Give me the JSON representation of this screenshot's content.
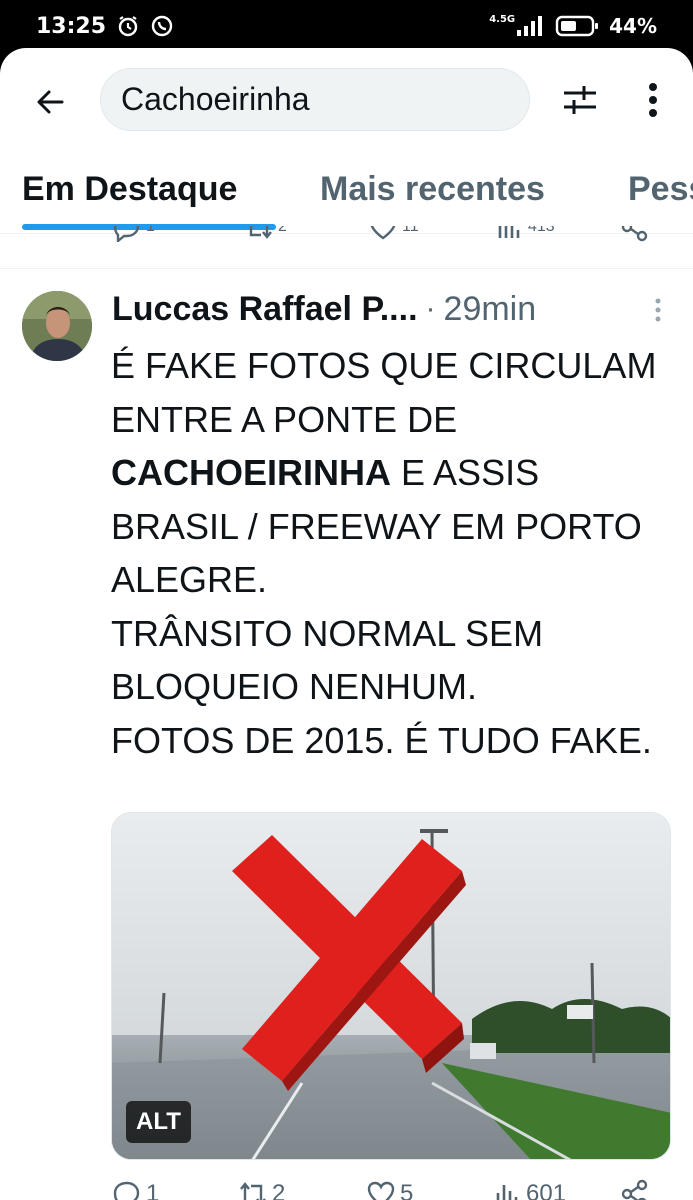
{
  "status_bar": {
    "time": "13:25",
    "network": "4.5G",
    "battery": "44%"
  },
  "search": {
    "query": "Cachoeirinha"
  },
  "tabs": [
    {
      "label": "Em Destaque",
      "active": true
    },
    {
      "label": "Mais recentes",
      "active": false
    },
    {
      "label": "Pessoas",
      "active": false
    }
  ],
  "previous_tweet_actions": {
    "replies": "1",
    "reposts": "2",
    "likes": "11",
    "views": "413"
  },
  "tweet": {
    "author": "Luccas Raffael P....",
    "separator": "·",
    "time": "29min",
    "text_lines": [
      {
        "parts": [
          {
            "text": "É FAKE FOTOS QUE CIRCULAM",
            "bold": false
          }
        ]
      },
      {
        "parts": [
          {
            "text": "ENTRE A PONTE DE",
            "bold": false
          }
        ]
      },
      {
        "parts": [
          {
            "text": "CACHOEIRINHA",
            "bold": true
          },
          {
            "text": " E ASSIS",
            "bold": false
          }
        ]
      },
      {
        "parts": [
          {
            "text": "BRASIL / FREEWAY EM PORTO",
            "bold": false
          }
        ]
      },
      {
        "parts": [
          {
            "text": "ALEGRE.",
            "bold": false
          }
        ]
      },
      {
        "parts": [
          {
            "text": "TRÂNSITO NORMAL SEM",
            "bold": false
          }
        ]
      },
      {
        "parts": [
          {
            "text": "BLOQUEIO NENHUM.",
            "bold": false
          }
        ]
      },
      {
        "parts": [
          {
            "text": "FOTOS DE 2015. É TUDO FAKE.",
            "bold": false
          }
        ]
      }
    ],
    "media_alt_badge": "ALT",
    "actions": {
      "replies": "1",
      "reposts": "2",
      "likes": "5",
      "views": "601"
    }
  },
  "colors": {
    "accent": "#1d9bf0",
    "text_primary": "#0f1419",
    "text_secondary": "#536471",
    "cross_red": "#e0201c"
  }
}
